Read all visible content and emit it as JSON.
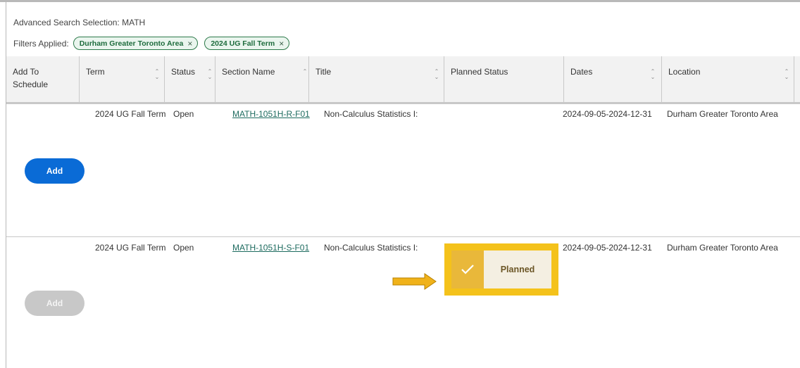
{
  "search": {
    "title": "Advanced Search Selection: MATH"
  },
  "filters": {
    "label": "Filters Applied:",
    "chips": [
      {
        "label": "Durham Greater Toronto Area",
        "remove": "×"
      },
      {
        "label": "2024 UG Fall Term",
        "remove": "×"
      }
    ]
  },
  "table": {
    "headers": {
      "add": "Add To\nSchedule",
      "term": "Term",
      "status": "Status",
      "section": "Section Name",
      "title": "Title",
      "planned": "Planned Status",
      "dates": "Dates",
      "location": "Location"
    },
    "rows": [
      {
        "add_label": "Add",
        "term": "2024 UG Fall Term",
        "status": "Open",
        "section": "MATH-1051H-R-F01",
        "title": "Non-Calculus Statistics I:",
        "planned": "",
        "dates": "2024-09-05-2024-12-31",
        "location": "Durham Greater Toronto Area"
      },
      {
        "add_label": "Add",
        "term": "2024 UG Fall Term",
        "status": "Open",
        "section": "MATH-1051H-S-F01",
        "title": "Non-Calculus Statistics I:",
        "planned": "Planned",
        "dates": "2024-09-05-2024-12-31",
        "location": "Durham Greater Toronto Area"
      }
    ]
  },
  "colors": {
    "accent_blue": "#0a6bd6",
    "chip_green": "#1d6b3c",
    "highlight_yellow": "#f4c21b",
    "arrow_orange": "#f0b21a"
  }
}
